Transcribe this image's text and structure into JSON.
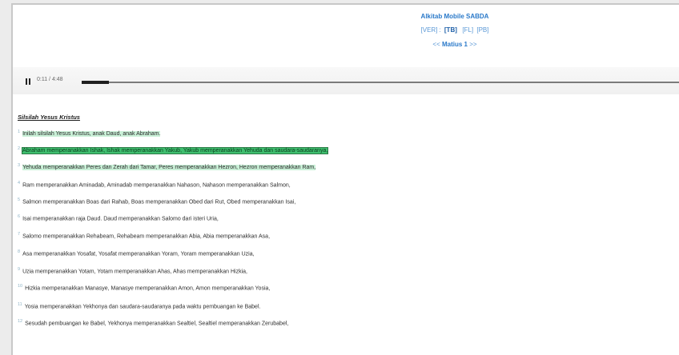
{
  "header": {
    "app_title": "Alkitab Mobile SABDA",
    "versions": [
      "[VER]",
      "[TB]",
      "[FL]",
      "[PB]"
    ],
    "version_separator": ":",
    "chapter_prev": "<<",
    "chapter_label": "Matius 1",
    "chapter_next": ">>"
  },
  "player": {
    "time": "0:11 / 4:48",
    "progress": 0.045
  },
  "content": {
    "section_heading": "Silsilah Yesus Kristus",
    "verses": [
      {
        "num": "1",
        "text": "Inilah silsilah Yesus Kristus, anak Daud, anak Abraham.",
        "highlight": "light"
      },
      {
        "num": "2",
        "text": "Abraham memperanakkan Ishak, Ishak memperanakkan Yakub, Yakub memperanakkan Yehuda dan saudara-saudaranya,",
        "highlight": "strong"
      },
      {
        "num": "3",
        "text": "Yehuda memperanakkan Peres dan Zerah dari Tamar, Peres memperanakkan Hezron, Hezron memperanakkan Ram,",
        "highlight": "light"
      },
      {
        "num": "4",
        "text": "Ram memperanakkan Aminadab, Aminadab memperanakkan Nahason, Nahason memperanakkan Salmon,",
        "highlight": "none"
      },
      {
        "num": "5",
        "text": "Salmon memperanakkan Boas dari Rahab, Boas memperanakkan Obed dari Rut, Obed memperanakkan Isai,",
        "highlight": "none"
      },
      {
        "num": "6",
        "text": "Isai memperanakkan raja Daud. Daud memperanakkan Salomo dari isteri Uria,",
        "highlight": "none"
      },
      {
        "num": "7",
        "text": "Salomo memperanakkan Rehabeam, Rehabeam memperanakkan Abia, Abia memperanakkan Asa,",
        "highlight": "none"
      },
      {
        "num": "8",
        "text": "Asa memperanakkan Yosafat, Yosafat memperanakkan Yoram, Yoram memperanakkan Uzia,",
        "highlight": "none"
      },
      {
        "num": "9",
        "text": "Uzia memperanakkan Yotam, Yotam memperanakkan Ahas, Ahas memperanakkan Hizkia,",
        "highlight": "none"
      },
      {
        "num": "10",
        "text": "Hizkia memperanakkan Manasye, Manasye memperanakkan Amon, Amon memperanakkan Yosia,",
        "highlight": "none"
      },
      {
        "num": "11",
        "text": "Yosia memperanakkan Yekhonya dan saudara-saudaranya pada waktu pembuangan ke Babel.",
        "highlight": "none"
      },
      {
        "num": "12",
        "text": "Sesudah pembuangan ke Babel, Yekhonya memperanakkan Sealtiel, Sealtiel memperanakkan Zerubabel,",
        "highlight": "none"
      }
    ]
  }
}
